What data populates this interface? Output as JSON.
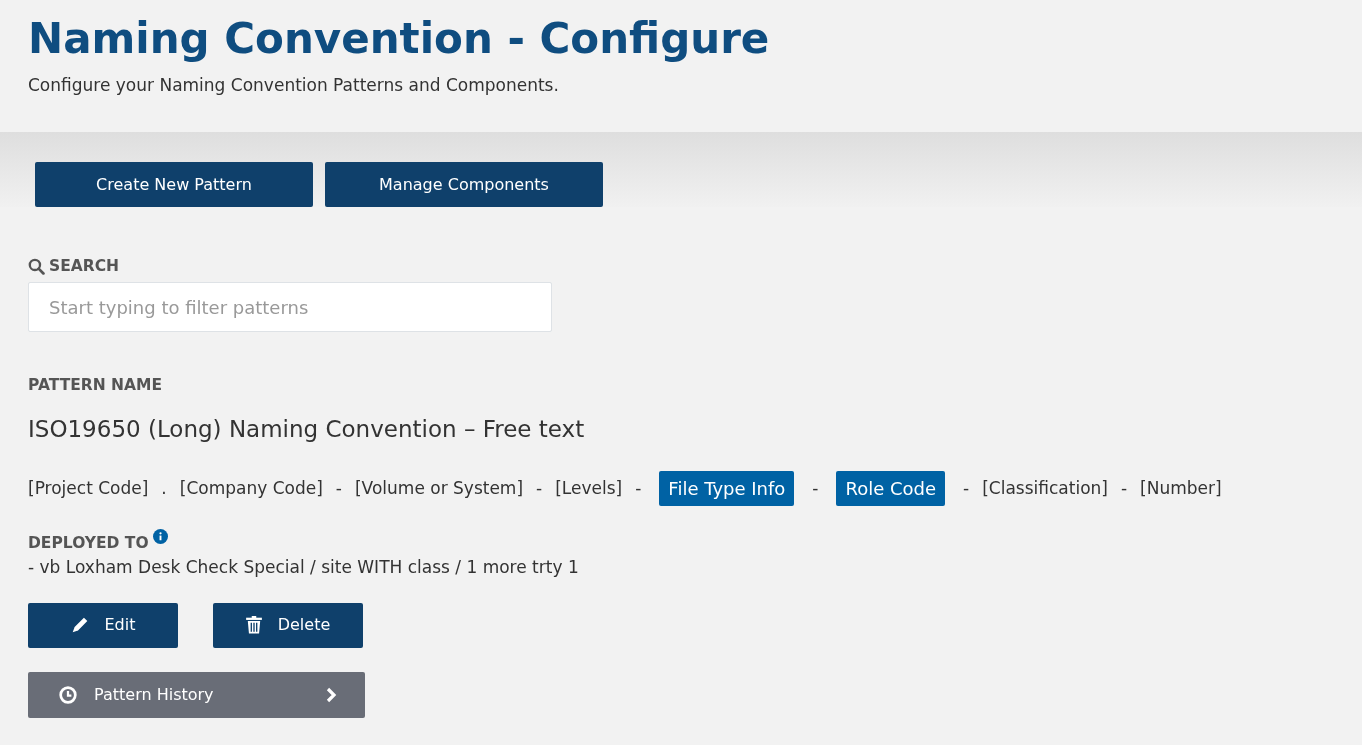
{
  "header": {
    "title": "Naming Convention - Configure",
    "subtitle": "Configure your Naming Convention Patterns and Components."
  },
  "toolbar": [
    "Create New Pattern",
    "Manage Components"
  ],
  "search": {
    "label": "SEARCH",
    "placeholder": "Start typing to filter patterns"
  },
  "pattern": {
    "heading": "PATTERN NAME",
    "name": "ISO19650 (Long) Naming Convention – Free text",
    "components": [
      {
        "kind": "plain",
        "text": "[Project Code]"
      },
      {
        "kind": "separator",
        "text": "."
      },
      {
        "kind": "plain",
        "text": "[Company Code]"
      },
      {
        "kind": "separator",
        "text": "-"
      },
      {
        "kind": "plain",
        "text": "[Volume or System]"
      },
      {
        "kind": "separator",
        "text": "-"
      },
      {
        "kind": "plain",
        "text": "[Levels]"
      },
      {
        "kind": "separator",
        "text": "-"
      },
      {
        "kind": "chip",
        "text": "File Type Info"
      },
      {
        "kind": "separator",
        "text": "-"
      },
      {
        "kind": "chip",
        "text": "Role Code"
      },
      {
        "kind": "separator",
        "text": "-"
      },
      {
        "kind": "plain",
        "text": "[Classification]"
      },
      {
        "kind": "separator",
        "text": "-"
      },
      {
        "kind": "plain",
        "text": "[Number]"
      }
    ],
    "deployed_heading": "DEPLOYED TO",
    "deployed": "- vb Loxham Desk Check Special / site WITH class / 1 more trty 1",
    "actions": [
      {
        "kind": "edit",
        "label": "Edit"
      },
      {
        "kind": "delete",
        "label": "Delete"
      }
    ],
    "history": "Pattern History"
  }
}
